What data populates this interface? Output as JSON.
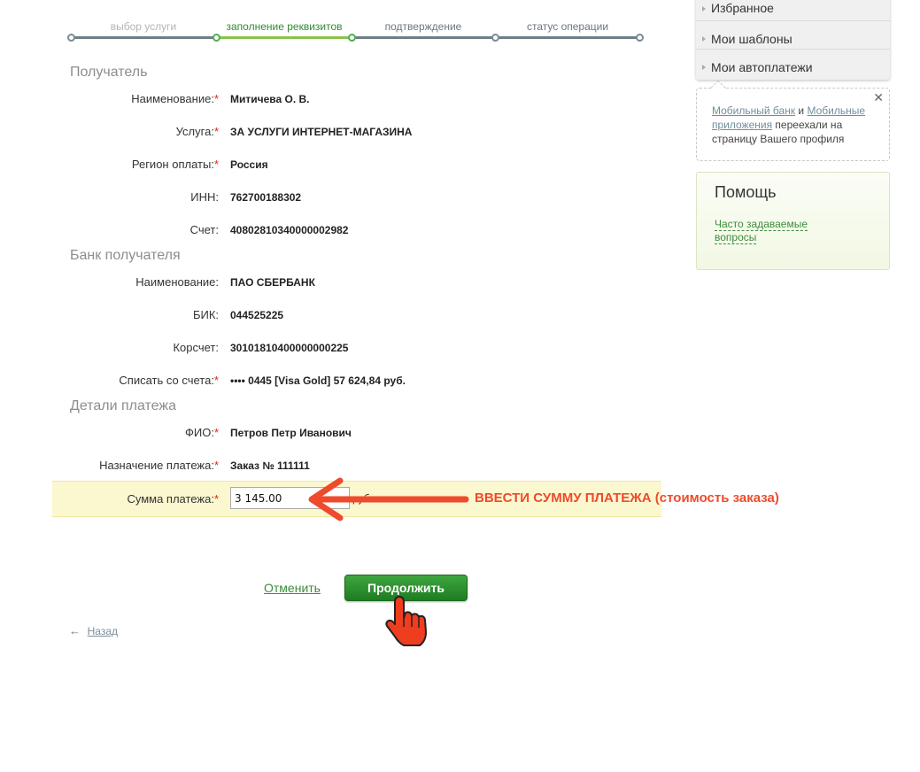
{
  "steps": [
    {
      "label": "выбор услуги"
    },
    {
      "label": "заполнение реквизитов"
    },
    {
      "label": "подтверждение"
    },
    {
      "label": "статус операции"
    }
  ],
  "recipient": {
    "title": "Получатель",
    "fields": [
      {
        "label": "Наименование:",
        "required": "*",
        "value": "Митичева О. В."
      },
      {
        "label": "Услуга:",
        "required": "*",
        "value": "ЗА УСЛУГИ ИНТЕРНЕТ-МАГАЗИНА"
      },
      {
        "label": "Регион оплаты:",
        "required": "*",
        "value": "Россия"
      },
      {
        "label": "ИНН:",
        "value": "762700188302"
      },
      {
        "label": "Счет:",
        "value": "40802810340000002982"
      }
    ]
  },
  "bank": {
    "title": "Банк получателя",
    "fields": [
      {
        "label": "Наименование:",
        "value": "ПАО СБЕРБАНК"
      },
      {
        "label": "БИК:",
        "value": "044525225"
      },
      {
        "label": "Корсчет:",
        "value": "30101810400000000225"
      },
      {
        "label": "Списать со счета:",
        "required": "*",
        "value": "•••• 0445  [Visa Gold] 57 624,84   руб."
      }
    ]
  },
  "details": {
    "title": "Детали платежа",
    "fields": [
      {
        "label": "ФИО:",
        "required": "*",
        "value": "Петров Петр Иванович"
      },
      {
        "label": "Назначение платежа:",
        "required": "*",
        "value": "Заказ № 111111"
      }
    ],
    "amount": {
      "label": "Сумма платежа:",
      "required": "*",
      "value": "3 145.00",
      "unit": "руб."
    }
  },
  "annotation": {
    "text": "ВВЕСТИ СУММУ ПЛАТЕЖА (стоимость заказа)",
    "color": "#ef4a2b"
  },
  "actions": {
    "cancel": "Отменить",
    "continue": "Продолжить",
    "back": "Назад",
    "back_arrow": "←"
  },
  "sidebar": {
    "menu": [
      {
        "label": "Избранное"
      },
      {
        "label": "Мои шаблоны"
      },
      {
        "label": "Мои автоплатежи"
      }
    ],
    "notice": {
      "close": "✕",
      "link1": "Мобильный банк",
      "and": " и ",
      "link2": "Мобильные приложения",
      "rest": " переехали на страницу Вашего профиля"
    },
    "help": {
      "title": "Помощь",
      "link": "Часто задаваемые вопросы"
    }
  },
  "colors": {
    "accent": "#2e8b2e",
    "button": "#1e7c23",
    "required": "#d8261b",
    "highlight_row": "#fbf7cf"
  }
}
